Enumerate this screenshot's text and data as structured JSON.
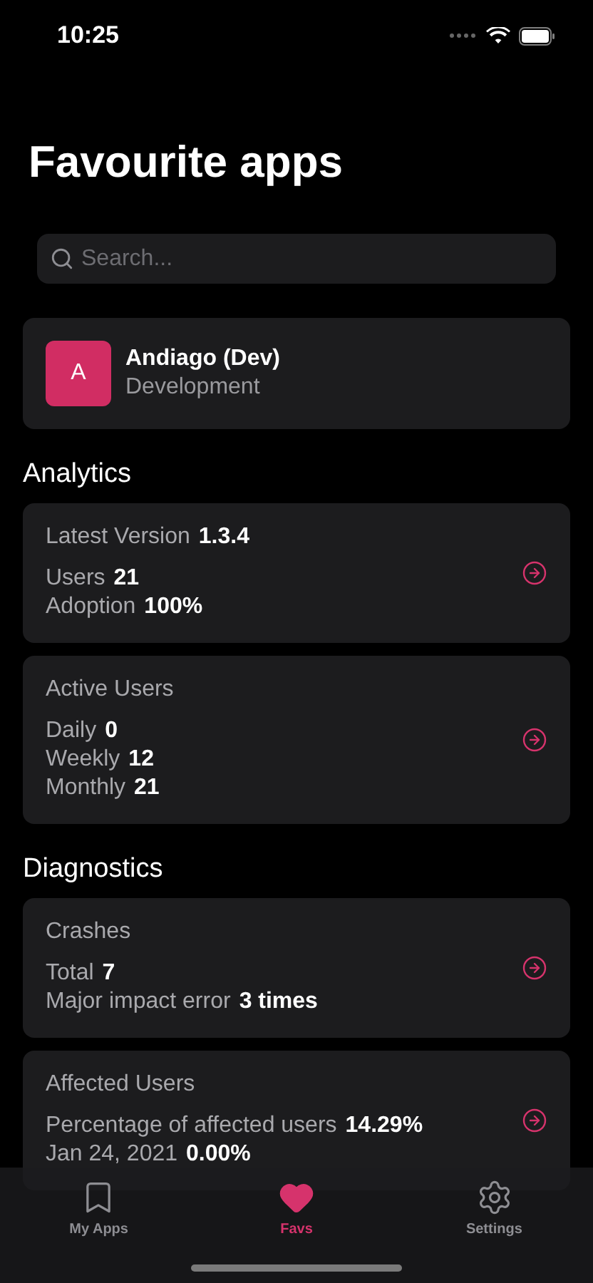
{
  "status_bar": {
    "time": "10:25"
  },
  "title": "Favourite apps",
  "search": {
    "placeholder": "Search..."
  },
  "app": {
    "initial": "A",
    "name": "Andiago (Dev)",
    "subtitle": "Development"
  },
  "sections": [
    {
      "title": "Analytics",
      "cards": [
        {
          "heading": {
            "label": "Latest Version",
            "value": "1.3.4"
          },
          "rows": [
            {
              "label": "Users",
              "value": "21"
            },
            {
              "label": "Adoption",
              "value": "100%"
            }
          ]
        },
        {
          "heading": {
            "label": "Active Users"
          },
          "rows": [
            {
              "label": "Daily",
              "value": "0"
            },
            {
              "label": "Weekly",
              "value": "12"
            },
            {
              "label": "Monthly",
              "value": "21"
            }
          ]
        }
      ]
    },
    {
      "title": "Diagnostics",
      "cards": [
        {
          "heading": {
            "label": "Crashes"
          },
          "rows": [
            {
              "label": "Total",
              "value": "7"
            },
            {
              "label": "Major impact error",
              "value": "3 times"
            }
          ]
        },
        {
          "heading": {
            "label": "Affected Users"
          },
          "rows": [
            {
              "label": "Percentage of affected users",
              "value": "14.29%"
            },
            {
              "label": "Jan 24, 2021",
              "value": "0.00%"
            }
          ]
        }
      ]
    }
  ],
  "tabs": [
    {
      "label": "My Apps",
      "kind": "bookmark",
      "selected": false
    },
    {
      "label": "Favs",
      "kind": "heart",
      "selected": true
    },
    {
      "label": "Settings",
      "kind": "gear",
      "selected": false
    }
  ]
}
